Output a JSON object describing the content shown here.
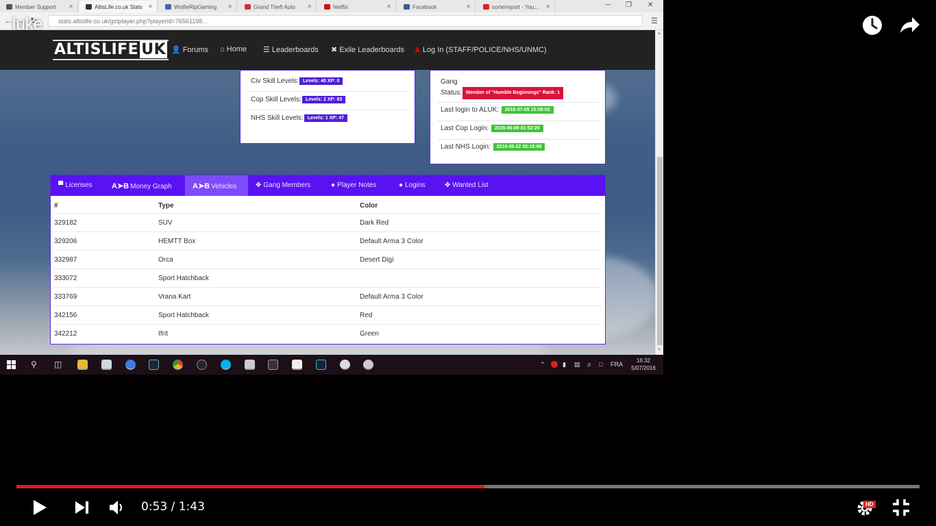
{
  "video": {
    "title": "luke",
    "current_time": "0:53",
    "separator": " / ",
    "duration": "1:43",
    "progress": 0.518,
    "hd_label": "HD",
    "controls": [
      "watch-later-icon",
      "share-icon",
      "play-icon",
      "next-icon",
      "volume-icon",
      "settings-icon",
      "exit-fullscreen-icon"
    ]
  },
  "browser": {
    "tabs": [
      {
        "label": "Member Support",
        "fav": "#555555"
      },
      {
        "label": "AltisLife.co.uk Stats",
        "fav": "#333333",
        "active": true
      },
      {
        "label": "WolfieRipGaming",
        "fav": "#4466aa"
      },
      {
        "label": "Grand Theft Auto",
        "fav": "#cc3333"
      },
      {
        "label": "Netflix",
        "fav": "#cc1111"
      },
      {
        "label": "Facebook",
        "fav": "#3b5998"
      },
      {
        "label": "sorte/report - You...",
        "fav": "#dd2222"
      }
    ],
    "url": "stats.altislife.co.uk/gstplayer.php?playerid=76561198..."
  },
  "site": {
    "logo_main": "ALTISLIFE",
    "logo_suffix": "UK",
    "nav": [
      {
        "icon": "user-icon",
        "glyph": "👤",
        "label": "Forums"
      },
      {
        "icon": "home-icon",
        "glyph": "⌂",
        "label": "Home"
      },
      {
        "icon": "list-icon",
        "glyph": "☰",
        "label": "Leaderboards"
      },
      {
        "icon": "cross-icon",
        "glyph": "✖",
        "label": "Exile Leaderboards"
      },
      {
        "icon": "login-icon",
        "glyph": "♟",
        "label": "Log In (STAFF/POLICE/NHS/UNMC)"
      }
    ]
  },
  "skills": {
    "civ_label": "Civ Skill Levels:",
    "civ_value": "Levels: 40 XP: 0",
    "cop_label": "Cop Skill Levels:",
    "cop_value": "Levels: 2 XP: 83",
    "nhs_label": "NHS Skill Levels:",
    "nhs_value": "Levels: 1 XP: 47"
  },
  "profile": {
    "gang_label_1": "Gang",
    "gang_label_2": "Status:",
    "gang_value": "Member of \"Humble Beginnings\" Rank: 1",
    "last_login_label": "Last login to ALUK:",
    "last_login_value": "2016-07-05 15:08:02",
    "last_cop_label": "Last Cop Login:",
    "last_cop_value": "2016-06-09 01:52:20",
    "last_nhs_label": "Last NHS Login:",
    "last_nhs_value": "2016-06-22 02:16:06"
  },
  "panel": {
    "tabs": [
      {
        "name": "tab-licenses",
        "icon": "▀",
        "prefix": "",
        "label": "Licenses"
      },
      {
        "name": "tab-money-graph",
        "icon": "",
        "prefix": "A➤B",
        "label": "Money Graph"
      },
      {
        "name": "tab-vehicles",
        "icon": "",
        "prefix": "A➤B",
        "label": "Vehicles",
        "active": true
      },
      {
        "name": "tab-gang-members",
        "icon": "✥",
        "prefix": "",
        "label": "Gang Members"
      },
      {
        "name": "tab-player-notes",
        "icon": "●",
        "prefix": "",
        "label": "Player Notes"
      },
      {
        "name": "tab-logins",
        "icon": "●",
        "prefix": "",
        "label": "Logins"
      },
      {
        "name": "tab-wanted-list",
        "icon": "✥",
        "prefix": "",
        "label": "Wanted List"
      }
    ],
    "columns": [
      "#",
      "Type",
      "Color"
    ],
    "rows": [
      [
        "329182",
        "SUV",
        "Dark Red"
      ],
      [
        "329206",
        "HEMTT Box",
        "Default Arma 3 Color"
      ],
      [
        "332987",
        "Orca",
        "Desert Digi"
      ],
      [
        "333072",
        "Sport Hatchback",
        ""
      ],
      [
        "333769",
        "Vrana Kart",
        "Default Arma 3 Color"
      ],
      [
        "342156",
        "Sport Hatchback",
        "Red"
      ],
      [
        "342212",
        "Ifrit",
        "Green"
      ]
    ]
  },
  "taskbar": {
    "lang": "FRA",
    "time": "16:32",
    "date": "5/07/2016"
  }
}
